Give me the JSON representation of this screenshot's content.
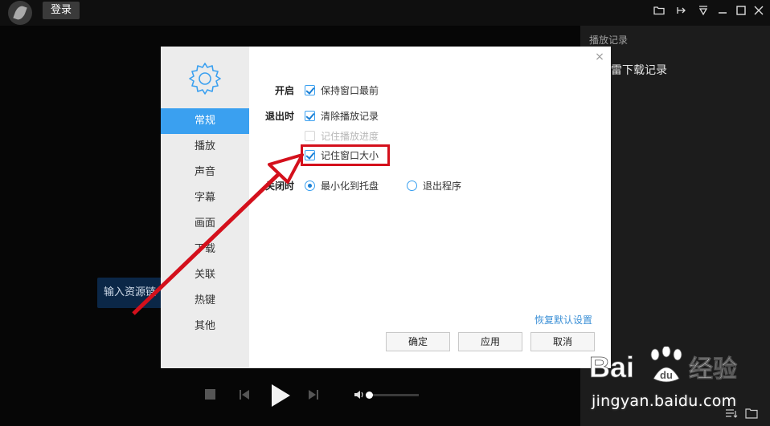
{
  "topbar": {
    "login_label": "登录"
  },
  "main": {
    "url_placeholder": "输入资源链"
  },
  "right_panel": {
    "title": "播放记录",
    "item": "雷下载记录"
  },
  "dialog": {
    "nav": [
      "常规",
      "播放",
      "声音",
      "字幕",
      "画面",
      "下载",
      "关联",
      "热键",
      "其他"
    ],
    "active_nav": "常规",
    "sections": {
      "startup": {
        "label": "开启",
        "options": [
          {
            "text": "保持窗口最前",
            "checked": true
          }
        ]
      },
      "on_exit": {
        "label": "退出时",
        "options": [
          {
            "text": "清除播放记录",
            "checked": true
          },
          {
            "text": "记住播放进度",
            "checked": false,
            "disabled": true
          },
          {
            "text": "记住窗口大小",
            "checked": true
          }
        ]
      },
      "on_close": {
        "label": "关闭时",
        "options": [
          {
            "text": "最小化到托盘",
            "selected": true
          },
          {
            "text": "退出程序",
            "selected": false
          }
        ]
      }
    },
    "restore_defaults": "恢复默认设置",
    "buttons": {
      "ok": "确定",
      "apply": "应用",
      "cancel": "取消"
    },
    "close": "×"
  },
  "player": {
    "volume": 0.03
  },
  "watermark": {
    "brand": "Bai du 经验",
    "url": "jingyan.baidu.com"
  },
  "colors": {
    "accent": "#3aa0f0",
    "annotation": "#d4101c",
    "link": "#3a8fd6"
  }
}
